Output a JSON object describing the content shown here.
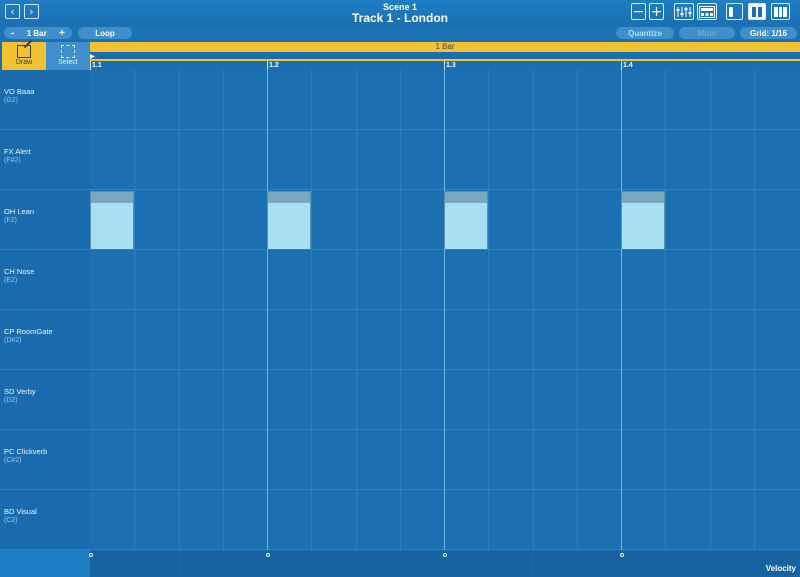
{
  "header": {
    "back_icon": "chevron-left-icon",
    "forward_icon": "chevron-right-icon",
    "scene_name": "Scene 1",
    "track_name": "Track 1 - London",
    "zoom_out_icon": "minus-box-icon",
    "zoom_in_icon": "plus-box-icon",
    "mixer_icon": "mixer-icon",
    "device_icon": "device-icon",
    "layout_single_icon": "layout-single-icon",
    "layout_split_icon": "layout-split-icon",
    "layout_triple_icon": "layout-triple-icon"
  },
  "toolbar": {
    "length_minus": "-",
    "length_value": "1 Bar",
    "length_plus": "+",
    "loop_label": "Loop",
    "quantize_label": "Quantize",
    "mute_label": "Mute",
    "grid_label": "Grid: 1/16"
  },
  "tools": {
    "draw_label": "Draw",
    "select_label": "Select"
  },
  "timeline": {
    "loop_label": "1 Bar",
    "bar_labels": [
      "1.1",
      "1.2",
      "1.3",
      "1.4"
    ]
  },
  "rows": [
    {
      "name": "VO Baaa",
      "note": "(G2)"
    },
    {
      "name": "FX Alert",
      "note": "(F#2)"
    },
    {
      "name": "OH Lean",
      "note": "(F2)"
    },
    {
      "name": "CH Nose",
      "note": "(E2)"
    },
    {
      "name": "CP RoomGate",
      "note": "(D#2)"
    },
    {
      "name": "SD Verby",
      "note": "(D2)"
    },
    {
      "name": "PC Clickverb",
      "note": "(C#2)"
    },
    {
      "name": "BD Visual",
      "note": "(C2)"
    }
  ],
  "notes": [
    {
      "row": 2,
      "step": 0
    },
    {
      "row": 2,
      "step": 4
    },
    {
      "row": 2,
      "step": 8
    },
    {
      "row": 2,
      "step": 12
    }
  ],
  "velocity": {
    "label": "Velocity"
  },
  "colors": {
    "accent": "#f2c230",
    "background": "#1a70b0",
    "note_fill": "#a8e0f3"
  }
}
